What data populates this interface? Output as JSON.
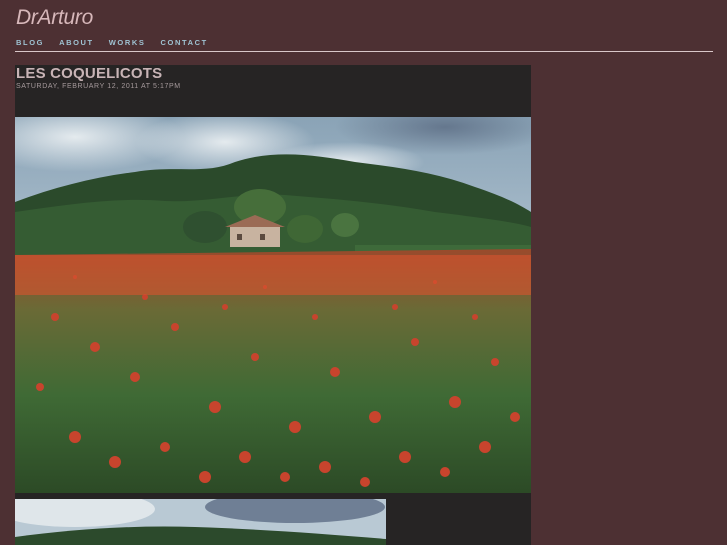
{
  "site": {
    "title": "DrArturo"
  },
  "nav": {
    "items": [
      "BLOG",
      "ABOUT",
      "WORKS",
      "CONTACT"
    ]
  },
  "post": {
    "title": "LES COQUELICOTS",
    "date": "SATURDAY, FEBRUARY 12, 2011 AT 5:17PM"
  },
  "colors": {
    "background": "#4d3033",
    "post_background": "#262424",
    "title_color": "#d7b7ba",
    "nav_color": "#9fc3d3"
  }
}
